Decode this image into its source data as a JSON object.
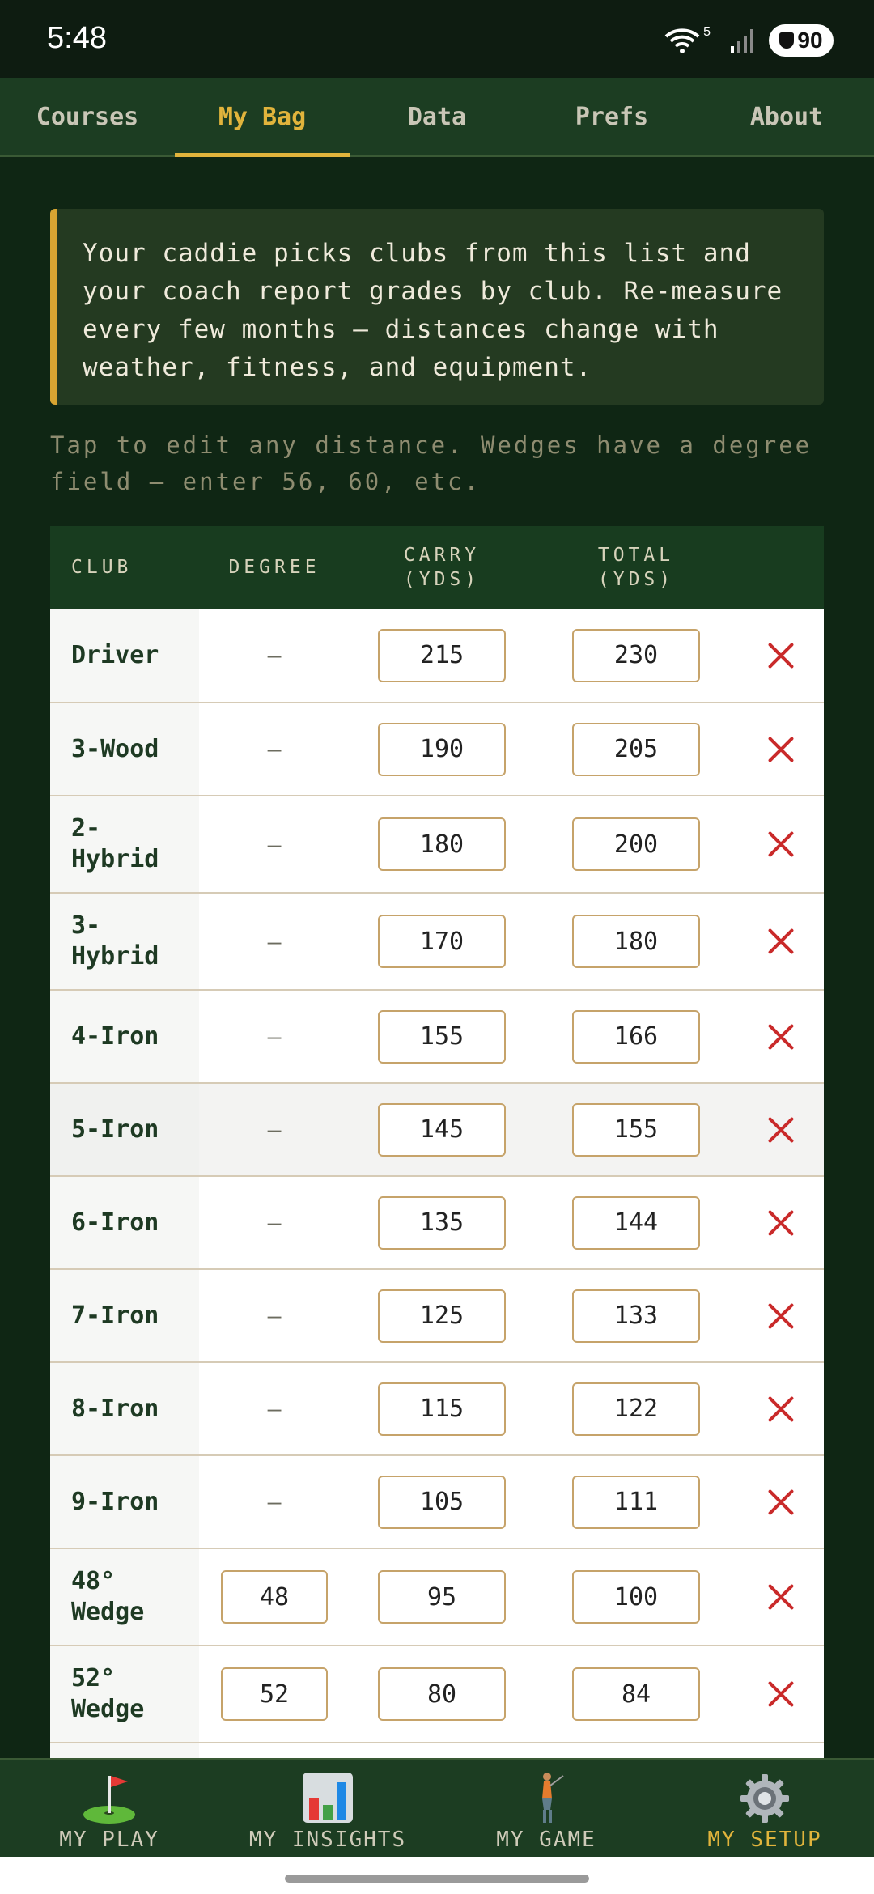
{
  "status": {
    "time": "5:48",
    "battery": "90",
    "wifi_badge": "5"
  },
  "tabs": [
    {
      "label": "Courses",
      "active": false
    },
    {
      "label": "My Bag",
      "active": true
    },
    {
      "label": "Data",
      "active": false
    },
    {
      "label": "Prefs",
      "active": false
    },
    {
      "label": "About",
      "active": false
    }
  ],
  "callout": {
    "text": "Your caddie picks clubs from this list and your coach report grades by club. Re-measure every few months — distances change with weather, fitness, and equipment."
  },
  "hint": "Tap to edit any distance. Wedges have a degree field — enter 56, 60, etc.",
  "table": {
    "headers": {
      "club": "CLUB",
      "degree": "DEGREE",
      "carry_1": "CARRY",
      "carry_2": "(YDS)",
      "total_1": "TOTAL",
      "total_2": "(YDS)"
    },
    "rows": [
      {
        "club": "Driver",
        "degree": "—",
        "carry": "215",
        "total": "230"
      },
      {
        "club": "3-Wood",
        "degree": "—",
        "carry": "190",
        "total": "205"
      },
      {
        "club": "2-Hybrid",
        "degree": "—",
        "carry": "180",
        "total": "200"
      },
      {
        "club": "3-Hybrid",
        "degree": "—",
        "carry": "170",
        "total": "180"
      },
      {
        "club": "4-Iron",
        "degree": "—",
        "carry": "155",
        "total": "166"
      },
      {
        "club": "5-Iron",
        "degree": "—",
        "carry": "145",
        "total": "155"
      },
      {
        "club": "6-Iron",
        "degree": "—",
        "carry": "135",
        "total": "144"
      },
      {
        "club": "7-Iron",
        "degree": "—",
        "carry": "125",
        "total": "133"
      },
      {
        "club": "8-Iron",
        "degree": "—",
        "carry": "115",
        "total": "122"
      },
      {
        "club": "9-Iron",
        "degree": "—",
        "carry": "105",
        "total": "111"
      },
      {
        "club": "48° Wedge",
        "degree": "48",
        "carry": "95",
        "total": "100"
      },
      {
        "club": "52° Wedge",
        "degree": "52",
        "carry": "80",
        "total": "84"
      }
    ]
  },
  "bottom_nav": [
    {
      "label": "MY PLAY",
      "icon": "golf-flag-icon",
      "active": false
    },
    {
      "label": "MY INSIGHTS",
      "icon": "bar-chart-icon",
      "active": false
    },
    {
      "label": "MY GAME",
      "icon": "golfer-icon",
      "active": false
    },
    {
      "label": "MY SETUP",
      "icon": "gear-icon",
      "active": true
    }
  ],
  "colors": {
    "accent": "#e1b43c",
    "background": "#0f2614",
    "delete": "#c92a2a"
  }
}
